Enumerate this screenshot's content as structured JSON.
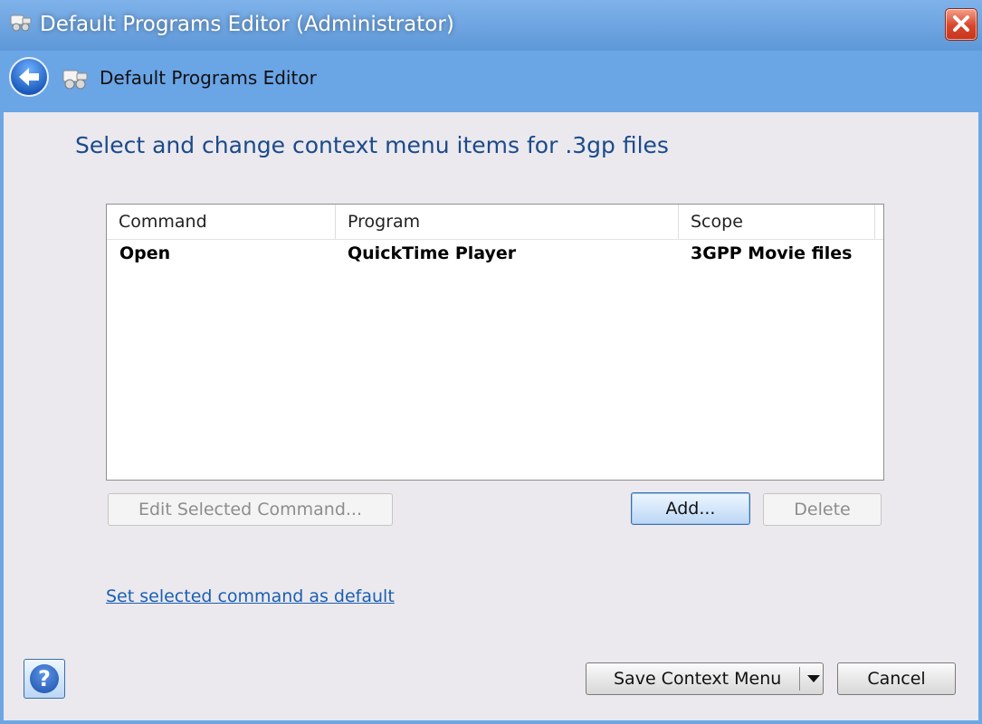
{
  "window": {
    "title": "Default Programs Editor (Administrator)",
    "title_icon": "programs-editor-icon",
    "close_icon": "close-icon"
  },
  "nav": {
    "back_icon": "back-arrow-icon",
    "breadcrumb": "Default Programs Editor"
  },
  "main": {
    "heading": "Select and change context menu items for .3gp files",
    "table": {
      "columns": [
        "Command",
        "Program",
        "Scope"
      ],
      "rows": [
        {
          "command": "Open",
          "program": "QuickTime Player",
          "scope": "3GPP Movie files"
        }
      ]
    },
    "buttons": {
      "edit": "Edit Selected Command...",
      "add": "Add...",
      "delete": "Delete"
    },
    "set_default_link": "Set selected command as default"
  },
  "footer": {
    "help_icon": "help-icon",
    "help_glyph": "?",
    "save": "Save Context Menu",
    "cancel": "Cancel"
  },
  "colors": {
    "titlebar": "#6ea6e4",
    "heading": "#1b4a8c",
    "link": "#1a5fb4",
    "content_bg": "#ebe9ed"
  }
}
